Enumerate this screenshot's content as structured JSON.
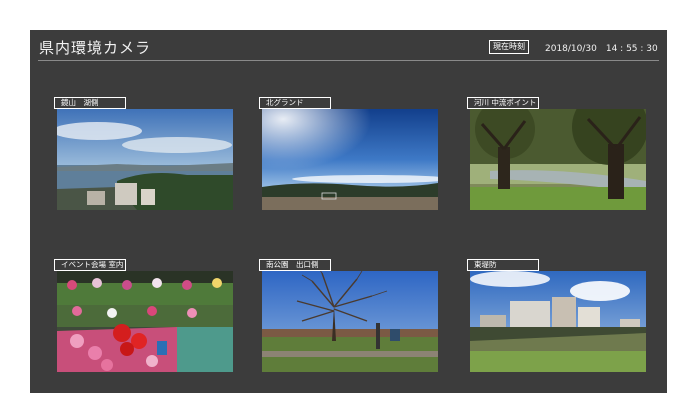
{
  "header": {
    "title": "県内環境カメラ",
    "current_time_label": "現在時刻",
    "datetime": "2018/10/30　14 : 55 : 30"
  },
  "cameras": [
    {
      "label": "鏡山　湖側",
      "scene": "lake-city"
    },
    {
      "label": "北グランド",
      "scene": "sports-ground-blue-sky"
    },
    {
      "label": "河川 中流ポイント",
      "scene": "riverside-willows"
    },
    {
      "label": "イベント会場 室内",
      "scene": "flower-display"
    },
    {
      "label": "南公園　出口側",
      "scene": "park-bare-tree"
    },
    {
      "label": "東堤防",
      "scene": "embankment-buildings"
    }
  ]
}
